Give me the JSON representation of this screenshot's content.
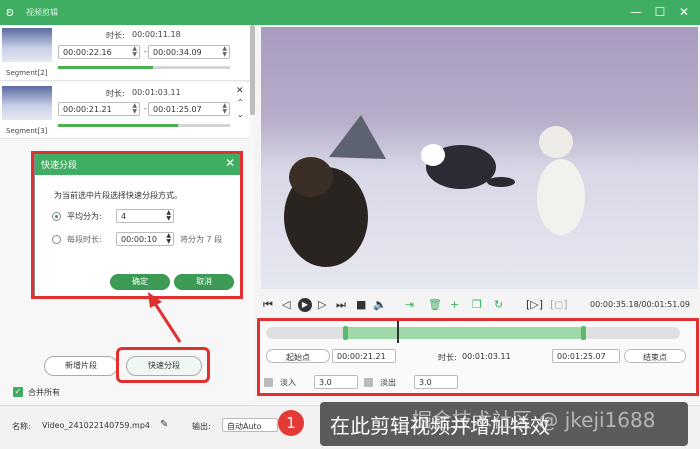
{
  "window": {
    "title": "视频剪辑",
    "logo_icon": "rabbit-logo-icon"
  },
  "segments": [
    {
      "label": "Segment[2]",
      "duration_label": "时长:",
      "duration": "00:00:11.18",
      "start": "00:00:22.16",
      "end": "00:00:34.09",
      "progress": 0.55
    },
    {
      "label": "Segment[3]",
      "duration_label": "时长:",
      "duration": "00:01:03.11",
      "start": "00:00:21.21",
      "end": "00:01:25.07",
      "progress": 0.7
    }
  ],
  "dialog": {
    "title": "快速分段",
    "prompt": "为当前选中片段选择快速分段方式。",
    "option1_label": "平均分为:",
    "option1_value": "4",
    "option2_label": "每段时长:",
    "option2_value": "00:00:10",
    "option2_suffix": "将分为 7 段",
    "ok": "确定",
    "cancel": "取消"
  },
  "left_actions": {
    "new_segment": "新增片段",
    "quick_split": "快速分段",
    "merge_all": "合并所有"
  },
  "player": {
    "time": "00:00:35.18/00:01:51.09"
  },
  "trim": {
    "start_btn": "起始点",
    "start_value": "00:00:21.21",
    "duration_label": "时长:",
    "duration_value": "00:01:03.11",
    "end_value": "00:01:25.07",
    "end_btn": "结束点",
    "fade_in_label": "淡入",
    "fade_in_value": "3.0",
    "fade_out_label": "淡出",
    "fade_out_value": "3.0"
  },
  "bottom": {
    "name_label": "名称:",
    "file_name": "Video_241022140759.mp4",
    "output_label": "输出:",
    "output_value": "自动Auto"
  },
  "annotation": {
    "badge": "1",
    "text": "在此剪辑视频并增加特效",
    "watermark": "掘金技术社区 @ jkeji1688"
  },
  "colors": {
    "accent": "#3fae62",
    "highlight": "#e03030"
  }
}
